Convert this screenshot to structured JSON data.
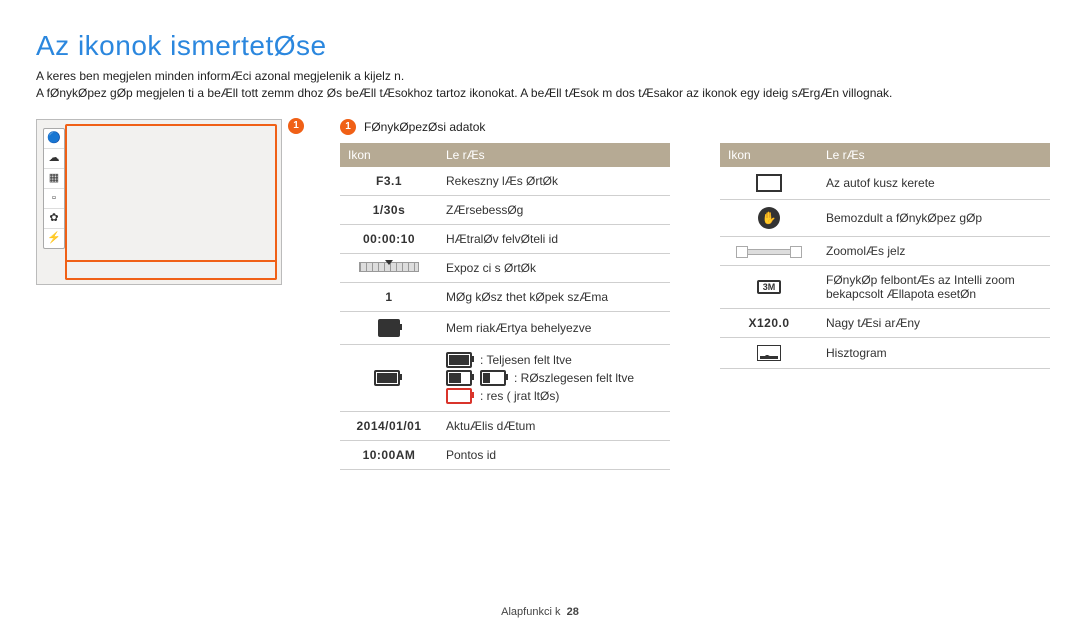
{
  "title": "Az ikonok ismertetØse",
  "intro_line1": "A keres ben megjelen  minden informÆci  azonal megjelenik a kijelz n.",
  "intro_line2": "A fØnykØpez gØp megjelen ti a beÆll tott  zemm dhoz Øs beÆll tÆsokhoz tartoz  ikonokat. A beÆll tÆsok m dos tÆsakor az ikonok egy ideig sÆrgÆn villognak.",
  "section": {
    "num": "1",
    "title": "FØnykØpezØsi adatok"
  },
  "th_icon": "Ikon",
  "th_desc": "Le rÆs",
  "left_rows": [
    {
      "icon_text": "F3.1",
      "icon_class": "ic-dig",
      "desc": "Rekeszny lÆs ØrtØk"
    },
    {
      "icon_text": "1/30s",
      "icon_class": "ic-dig",
      "desc": "ZÆrsebessØg"
    },
    {
      "icon_text": "00:00:10",
      "icon_class": "ic-dig",
      "desc": "HÆtralØv  felvØteli id"
    },
    {
      "icon_html": "scale",
      "desc": "Expoz ci s ØrtØk"
    },
    {
      "icon_text": "1",
      "icon_class": "ic-dig",
      "desc": "MØg kØsz thet  kØpek szÆma"
    },
    {
      "icon_html": "mem",
      "desc": "Mem riakÆrtya behelyezve"
    },
    {
      "icon_html": "batt",
      "battery": {
        "full": "Teljesen felt ltve",
        "partial": "RØszlegesen felt ltve",
        "empty": "res ( jrat ltØs)"
      }
    },
    {
      "icon_text": "2014/01/01",
      "icon_class": "ic-dig",
      "desc": "AktuÆlis dÆtum"
    },
    {
      "icon_text": "10:00AM",
      "icon_class": "ic-dig",
      "desc": "Pontos id"
    }
  ],
  "right_rows": [
    {
      "icon_html": "af",
      "desc": "Az autof kusz kerete"
    },
    {
      "icon_html": "shake",
      "desc": "Bemozdult a fØnykØpez gØp"
    },
    {
      "icon_html": "zoom",
      "desc": "ZoomolÆs jelz"
    },
    {
      "icon_html": "res",
      "icon_text": "3M",
      "desc": "FØnykØp felbontÆs az Intelli zoom bekapcsolt Ællapota esetØn"
    },
    {
      "icon_text": "X120.0",
      "icon_class": "ic-dig",
      "desc": "Nagy tÆsi arÆny"
    },
    {
      "icon_html": "histo",
      "desc": "Hisztogram"
    }
  ],
  "footer": {
    "section": "Alapfunkci k",
    "page": "28"
  }
}
